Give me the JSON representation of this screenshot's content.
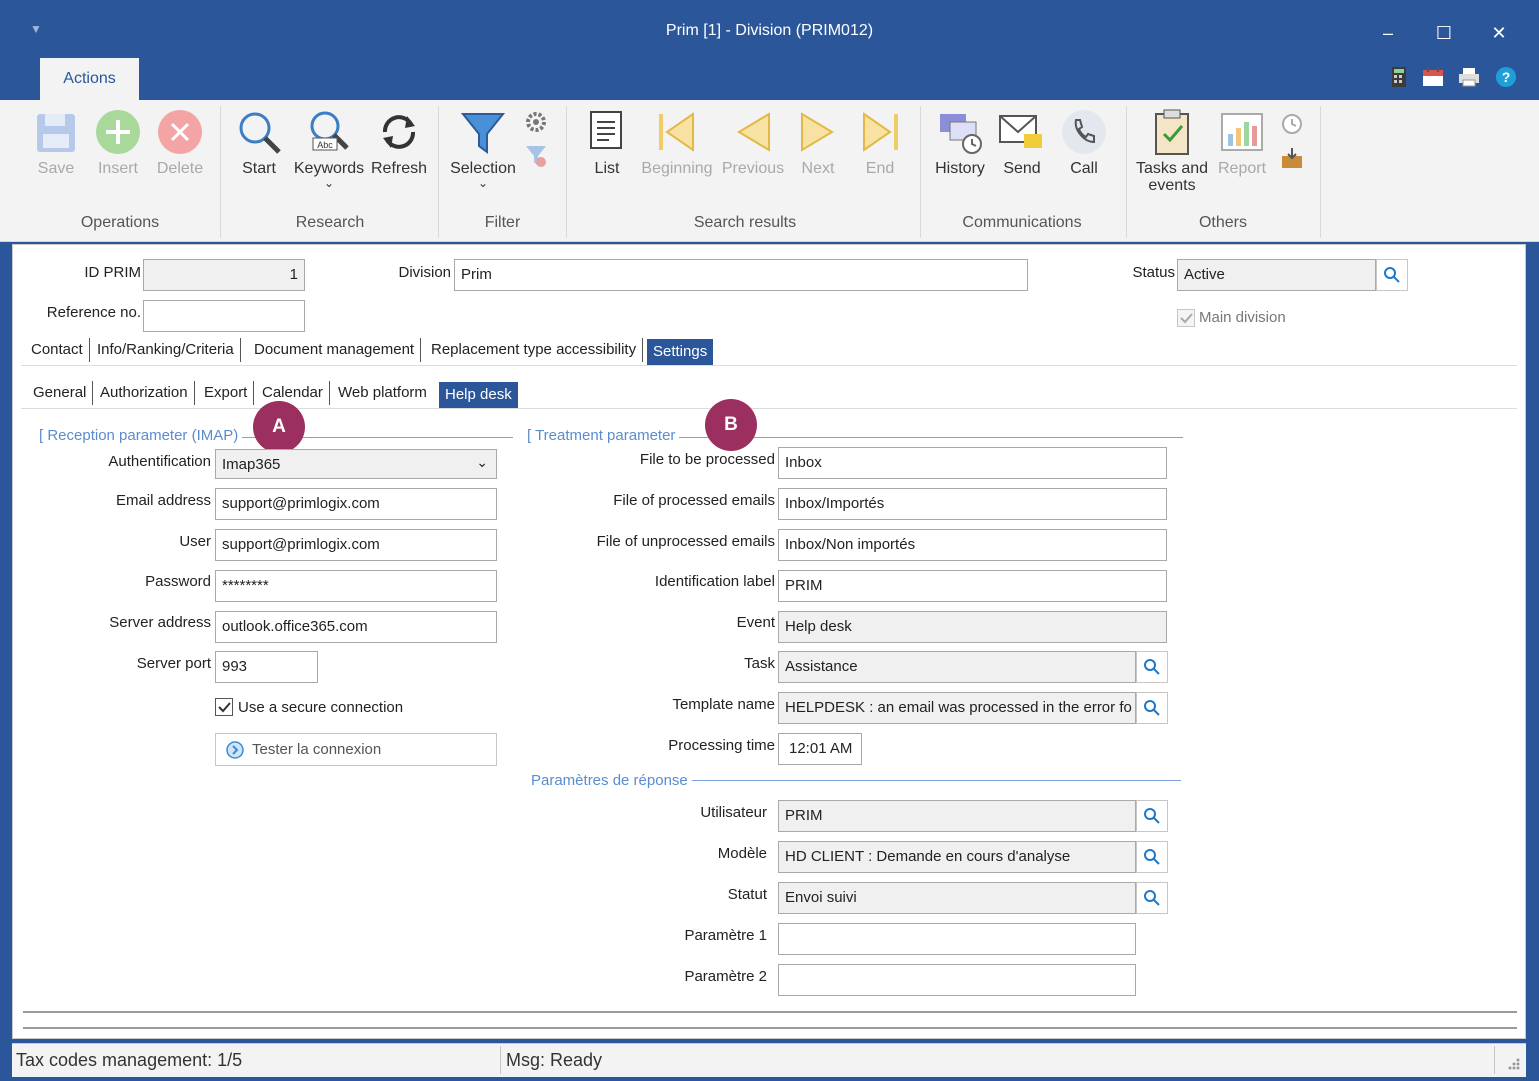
{
  "window": {
    "title": "Prim [1] - Division (PRIM012)"
  },
  "ribbon": {
    "tab": "Actions",
    "groups": {
      "operations": "Operations",
      "research": "Research",
      "filter": "Filter",
      "search_results": "Search results",
      "communications": "Communications",
      "others": "Others"
    },
    "buttons": {
      "save": "Save",
      "insert": "Insert",
      "delete": "Delete",
      "start": "Start",
      "keywords": "Keywords",
      "refresh": "Refresh",
      "selection": "Selection",
      "list": "List",
      "beginning": "Beginning",
      "previous": "Previous",
      "next": "Next",
      "end": "End",
      "history": "History",
      "send": "Send",
      "call": "Call",
      "tasks_line1": "Tasks and",
      "tasks_line2": "events",
      "report": "Report"
    }
  },
  "header": {
    "id_prim_label": "ID PRIM",
    "id_prim_value": "1",
    "division_label": "Division",
    "division_value": "Prim",
    "status_label": "Status",
    "status_value": "Active",
    "reference_label": "Reference no.",
    "reference_value": "",
    "main_division_label": "Main division"
  },
  "tabs": [
    "Contact",
    "Info/Ranking/Criteria",
    "Document management",
    "Replacement type accessibility",
    "Settings"
  ],
  "subtabs": [
    "General",
    "Authorization",
    "Export",
    "Calendar",
    "Web platform",
    "Help desk"
  ],
  "reception": {
    "title": "Reception parameter (IMAP)",
    "badge": "A",
    "auth_label": "Authentification",
    "auth_value": "Imap365",
    "email_label": "Email address",
    "email_value": "support@primlogix.com",
    "user_label": "User",
    "user_value": "support@primlogix.com",
    "password_label": "Password",
    "password_value": "********",
    "server_label": "Server address",
    "server_value": "outlook.office365.com",
    "port_label": "Server port",
    "port_value": "993",
    "secure_label": "Use a secure connection",
    "test_label": "Tester la connexion"
  },
  "treatment": {
    "title": "Treatment parameter",
    "badge": "B",
    "file_label": "File to be processed",
    "file_value": "Inbox",
    "processed_label": "File of processed emails",
    "processed_value": "Inbox/Importés",
    "unprocessed_label": "File of unprocessed emails",
    "unprocessed_value": "Inbox/Non importés",
    "ident_label": "Identification label",
    "ident_value": "PRIM",
    "event_label": "Event",
    "event_value": "Help desk",
    "task_label": "Task",
    "task_value": "Assistance",
    "template_label": "Template name",
    "template_value": "HELPDESK : an email was processed in the error fo",
    "time_label": "Processing time",
    "time_value": "12:01 AM"
  },
  "response": {
    "title": "Paramètres de réponse",
    "user_label": "Utilisateur",
    "user_value": "PRIM",
    "model_label": "Modèle",
    "model_value": "HD CLIENT : Demande en cours d'analyse",
    "status_label": "Statut",
    "status_value": "Envoi suivi",
    "param1_label": "Paramètre 1",
    "param1_value": "",
    "param2_label": "Paramètre 2",
    "param2_value": ""
  },
  "statusbar": {
    "left": "Tax codes management: 1/5",
    "right": "Msg: Ready"
  }
}
